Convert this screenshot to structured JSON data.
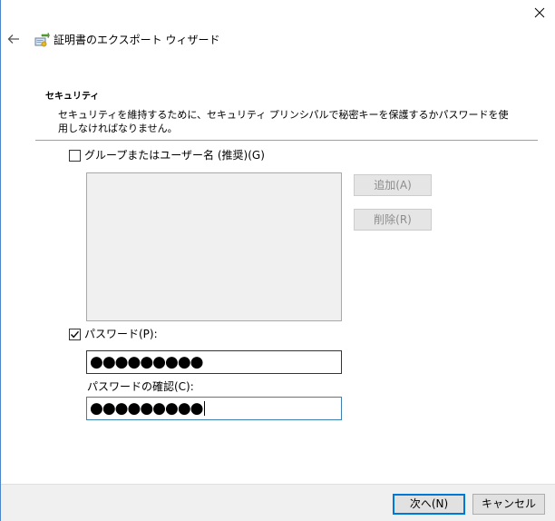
{
  "wizard": {
    "title": "証明書のエクスポート ウィザード"
  },
  "section": {
    "title": "セキュリティ",
    "description": "セキュリティを維持するために、セキュリティ プリンシパルで秘密キーを保護するかパスワードを使用しなければなりません。"
  },
  "group_option": {
    "label": "グループまたはユーザー名 (推奨)(G)",
    "checked": false
  },
  "buttons": {
    "add": "追加(A)",
    "remove": "削除(R)",
    "next": "次へ(N)",
    "cancel": "キャンセル"
  },
  "password_option": {
    "label": "パスワード(P):",
    "checked": true,
    "masked_value": "●●●●●●●●●"
  },
  "confirm": {
    "label": "パスワードの確認(C):",
    "masked_value": "●●●●●●●●●"
  },
  "colors": {
    "accent": "#0078d7",
    "focus_border": "#3c7fb1",
    "footer_bg": "#f0f0f0"
  },
  "icons": [
    "close-icon",
    "back-arrow-icon",
    "certificate-wizard-icon",
    "checkmark-icon"
  ]
}
